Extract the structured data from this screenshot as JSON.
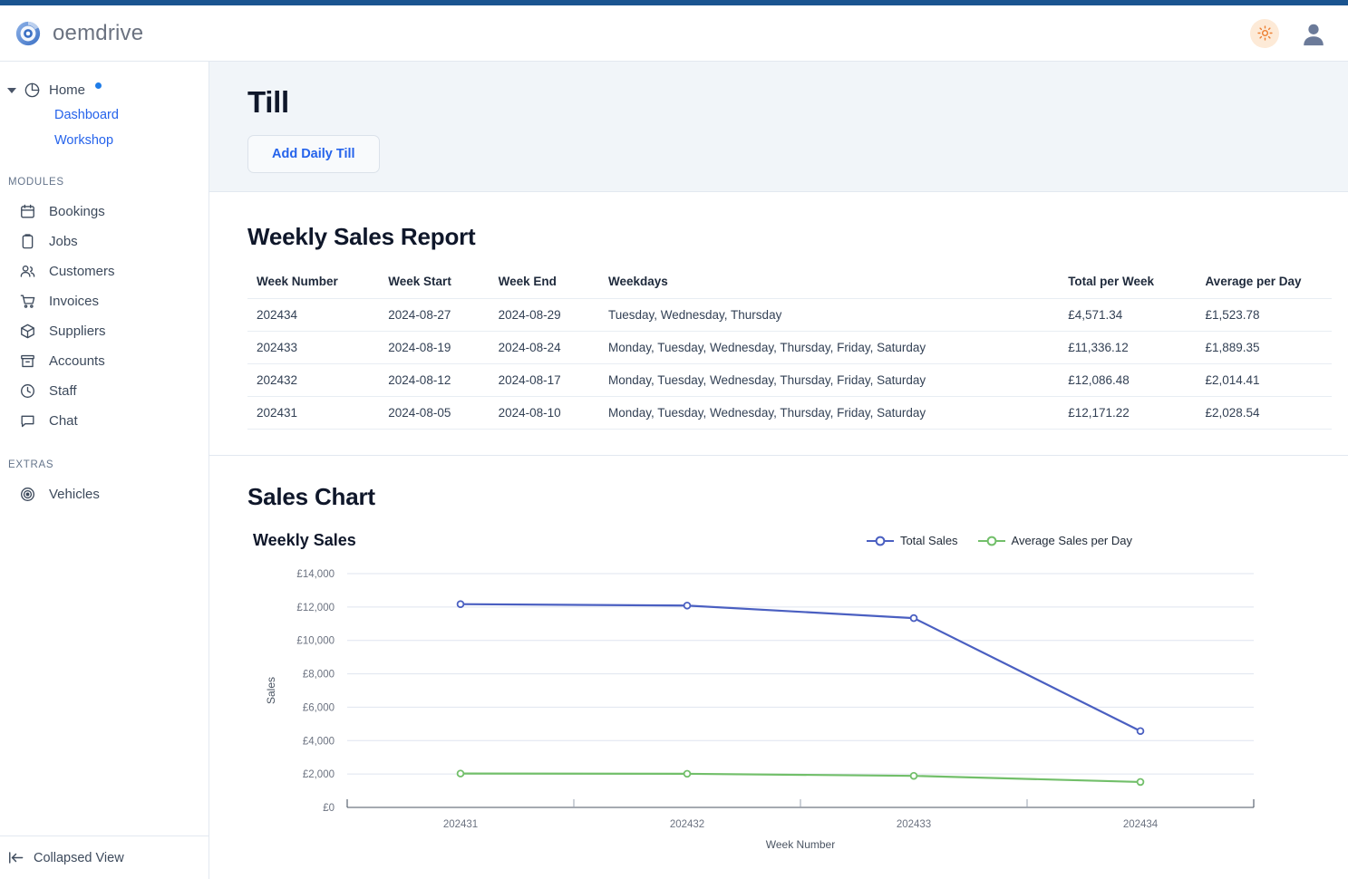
{
  "app": {
    "brand_name": "oemdrive",
    "theme_toggle_icon": "sun-icon",
    "avatar_icon": "user-avatar-icon"
  },
  "sidebar": {
    "home": {
      "label": "Home",
      "icon": "pie-chart-icon",
      "has_badge_dot": true
    },
    "home_children": [
      {
        "label": "Dashboard"
      },
      {
        "label": "Workshop"
      }
    ],
    "groups": [
      {
        "label": "MODULES",
        "items": [
          {
            "label": "Bookings",
            "icon": "calendar-icon"
          },
          {
            "label": "Jobs",
            "icon": "clipboard-icon"
          },
          {
            "label": "Customers",
            "icon": "users-icon"
          },
          {
            "label": "Invoices",
            "icon": "shopping-cart-icon"
          },
          {
            "label": "Suppliers",
            "icon": "box-icon"
          },
          {
            "label": "Accounts",
            "icon": "archive-icon"
          },
          {
            "label": "Staff",
            "icon": "clock-icon"
          },
          {
            "label": "Chat",
            "icon": "message-icon"
          }
        ]
      },
      {
        "label": "EXTRAS",
        "items": [
          {
            "label": "Vehicles",
            "icon": "target-icon"
          }
        ]
      }
    ],
    "footer": {
      "label": "Collapsed View",
      "icon": "collapse-left-icon"
    }
  },
  "page": {
    "title": "Till",
    "primary_action": "Add Daily Till"
  },
  "report": {
    "title": "Weekly Sales Report",
    "columns": [
      "Week Number",
      "Week Start",
      "Week End",
      "Weekdays",
      "Total per Week",
      "Average per Day"
    ],
    "rows": [
      {
        "week_number": "202434",
        "week_start": "2024-08-27",
        "week_end": "2024-08-29",
        "weekdays": "Tuesday, Wednesday, Thursday",
        "total_per_week": "£4,571.34",
        "average_per_day": "£1,523.78"
      },
      {
        "week_number": "202433",
        "week_start": "2024-08-19",
        "week_end": "2024-08-24",
        "weekdays": "Monday, Tuesday, Wednesday, Thursday, Friday, Saturday",
        "total_per_week": "£11,336.12",
        "average_per_day": "£1,889.35"
      },
      {
        "week_number": "202432",
        "week_start": "2024-08-12",
        "week_end": "2024-08-17",
        "weekdays": "Monday, Tuesday, Wednesday, Thursday, Friday, Saturday",
        "total_per_week": "£12,086.48",
        "average_per_day": "£2,014.41"
      },
      {
        "week_number": "202431",
        "week_start": "2024-08-05",
        "week_end": "2024-08-10",
        "weekdays": "Monday, Tuesday, Wednesday, Thursday, Friday, Saturday",
        "total_per_week": "£12,171.22",
        "average_per_day": "£2,028.54"
      }
    ]
  },
  "chart_section": {
    "title": "Sales Chart"
  },
  "chart_data": {
    "type": "line",
    "title": "Weekly Sales",
    "xlabel": "Week Number",
    "ylabel": "Sales",
    "categories": [
      "202431",
      "202432",
      "202433",
      "202434"
    ],
    "ylim": [
      0,
      14000
    ],
    "ytick_labels": [
      "£14,000",
      "£12,000",
      "£10,000",
      "£8,000",
      "£6,000",
      "£4,000",
      "£2,000",
      "£0"
    ],
    "yticks": [
      14000,
      12000,
      10000,
      8000,
      6000,
      4000,
      2000,
      0
    ],
    "grid": true,
    "legend_position": "top-right",
    "series": [
      {
        "name": "Total Sales",
        "color": "#4a5fc1",
        "values": [
          12171.22,
          12086.48,
          11336.12,
          4571.34
        ]
      },
      {
        "name": "Average Sales per Day",
        "color": "#72bf6a",
        "values": [
          2028.54,
          2014.41,
          1889.35,
          1523.78
        ]
      }
    ]
  },
  "colors": {
    "top_accent": "#1a5490",
    "link_blue": "#2563eb",
    "banner_bg": "#f1f5f9",
    "series_blue": "#4a5fc1",
    "series_green": "#72bf6a",
    "sun_icon": "#ed7f32"
  }
}
